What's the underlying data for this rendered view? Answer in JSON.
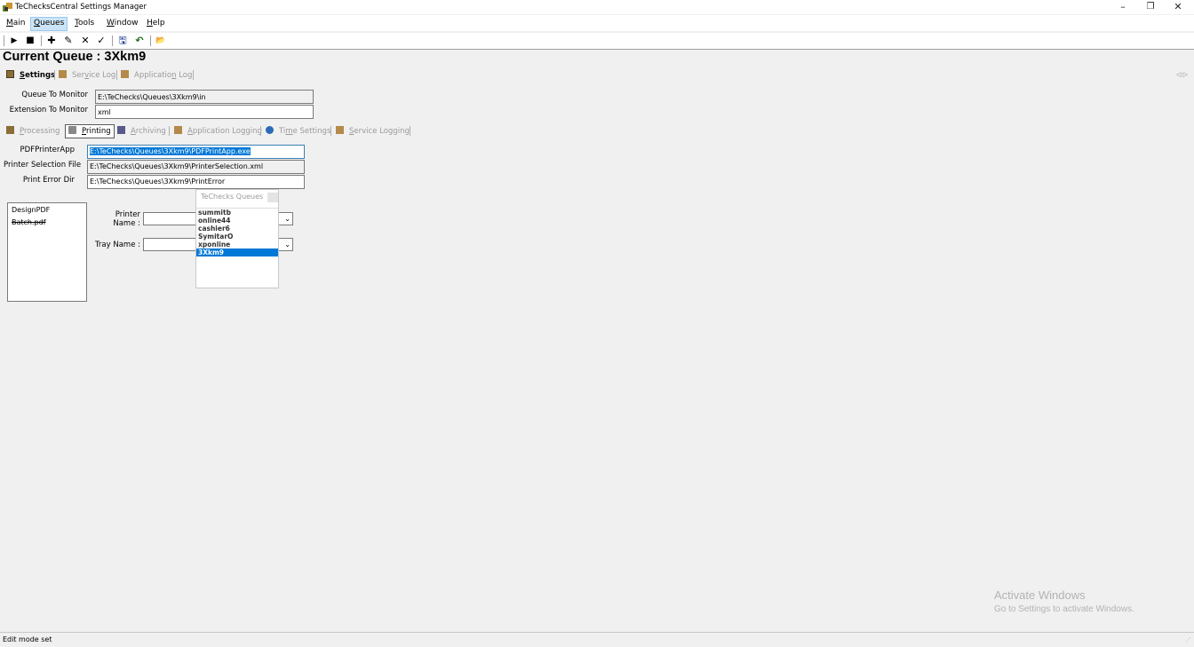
{
  "window": {
    "title": "TeChecksCentral Settings Manager",
    "minimize_glyph": "–",
    "restore_glyph": "❐",
    "close_glyph": "✕"
  },
  "menu": [
    {
      "mn": "M",
      "rest": "ain"
    },
    {
      "mn": "Q",
      "rest": "ueues"
    },
    {
      "mn": "T",
      "rest": "ools"
    },
    {
      "mn": "W",
      "rest": "indow"
    },
    {
      "mn": "H",
      "rest": "elp"
    }
  ],
  "toolbar": {
    "icons": [
      "play-icon",
      "stop-icon",
      "add-icon",
      "edit-icon",
      "delete-icon",
      "confirm-icon",
      "save-icon",
      "undo-icon",
      "open-folder-icon"
    ],
    "glyphs": {
      "play": "▶",
      "stop": "■",
      "add": "✚",
      "edit": "✎",
      "delete": "✕",
      "confirm": "✓",
      "save": "🖫",
      "undo": "↶",
      "open": "📂"
    }
  },
  "heading": "Current Queue : 3Xkm9",
  "main_tabs": {
    "settings": {
      "pre": "",
      "mn": "S",
      "post": "ettings"
    },
    "service_log": {
      "pre": "Ser",
      "mn": "v",
      "post": "ice Log"
    },
    "application_log": {
      "pre": "Applicatio",
      "mn": "n",
      "post": " Log"
    },
    "scroll_glyph": "◁ ▷"
  },
  "queue_fields": {
    "queue_to_monitor_label": "Queue To Monitor",
    "queue_to_monitor_value": "E:\\TeChecks\\Queues\\3Xkm9\\in",
    "extension_label": "Extension To Monitor",
    "extension_value": "xml"
  },
  "sub_tabs": {
    "processing": {
      "pre": "",
      "mn": "P",
      "post": "rocessing"
    },
    "printing": {
      "pre": "",
      "mn": "P",
      "post": "rinting"
    },
    "archiving": {
      "pre": "",
      "mn": "A",
      "post": "rchiving"
    },
    "application_logging": {
      "pre": "",
      "mn": "A",
      "post": "pplication Logging"
    },
    "time_settings": {
      "pre": "Ti",
      "mn": "m",
      "post": "e Settings"
    },
    "service_logging": {
      "pre": "",
      "mn": "S",
      "post": "ervice Logging"
    }
  },
  "printing": {
    "pdfprinterapp_label": "PDFPrinterApp",
    "pdfprinterapp_value": "E:\\TeChecks\\Queues\\3Xkm9\\PDFPrintApp.exe",
    "selection_file_label": "Printer Selection File",
    "selection_file_value": "E:\\TeChecks\\Queues\\3Xkm9\\PrinterSelection.xml",
    "error_dir_label": "Print Error Dir",
    "error_dir_value": "E:\\TeChecks\\Queues\\3Xkm9\\PrintError",
    "list_items": [
      "DesignPDF",
      "Batch.pdf"
    ],
    "printer_name_label_1": "Printer",
    "printer_name_label_2": "Name :",
    "printer_name_value": "",
    "tray_name_label": "Tray Name :",
    "tray_name_value": ""
  },
  "queue_popup": {
    "title": "TeChecks Queues",
    "items": [
      "summitb",
      "online44",
      "cashier6",
      "SymitarO",
      "xponline",
      "3Xkm9"
    ],
    "selected": "3Xkm9"
  },
  "watermark": {
    "line1": "Activate Windows",
    "line2": "Go to Settings to activate Windows."
  },
  "status": "Edit mode set",
  "colors": {
    "selection": "#0078d7",
    "menu_active": "#cce4f7"
  }
}
